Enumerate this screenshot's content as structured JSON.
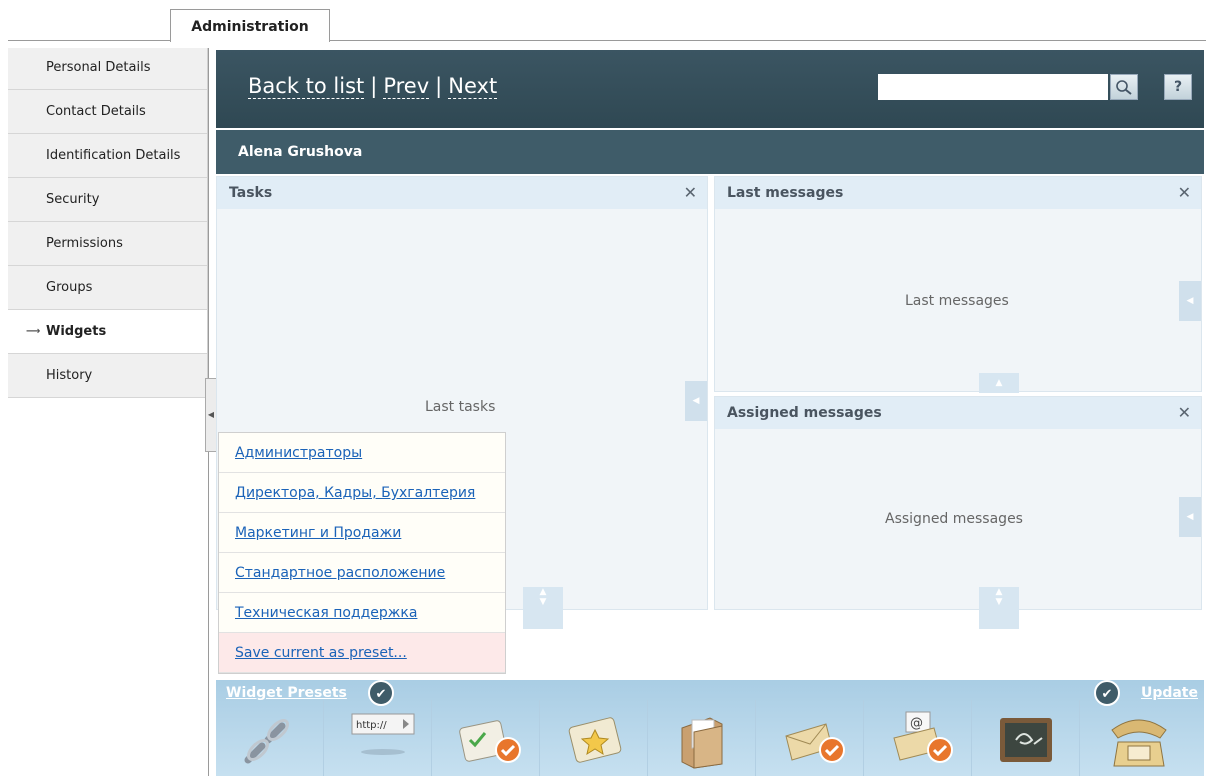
{
  "tab": {
    "label": "Administration"
  },
  "sidebar": {
    "items": [
      {
        "label": "Personal Details"
      },
      {
        "label": "Contact Details"
      },
      {
        "label": "Identification Details"
      },
      {
        "label": "Security"
      },
      {
        "label": "Permissions"
      },
      {
        "label": "Groups"
      },
      {
        "label": "Widgets",
        "active": true
      },
      {
        "label": "History"
      }
    ]
  },
  "header": {
    "back_label": "Back to list",
    "prev_label": "Prev",
    "next_label": "Next",
    "separator": "|",
    "search_placeholder": "",
    "help_label": "?"
  },
  "user": {
    "name": "Alena Grushova"
  },
  "widgets": {
    "tasks": {
      "title": "Tasks",
      "body": "Last tasks"
    },
    "last_messages": {
      "title": "Last messages",
      "body": "Last messages"
    },
    "assigned_messages": {
      "title": "Assigned messages",
      "body": "Assigned messages"
    },
    "close_glyph": "✕"
  },
  "presets": {
    "items": [
      "Администраторы",
      "Директора, Кадры, Бухгалтерия",
      "Маркетинг и Продажи",
      "Стандартное расположение",
      "Техническая поддержка"
    ],
    "save_label": "Save current as preset..."
  },
  "toolbar": {
    "presets_label": "Widget Presets",
    "update_label": "Update",
    "icons": [
      "link-icon",
      "url-icon",
      "tasks-icon",
      "favorites-icon",
      "documents-icon",
      "messages-icon",
      "email-icon",
      "chalkboard-icon",
      "phone-icon"
    ]
  },
  "colors": {
    "header": "#2f4853",
    "userbar": "#3f5c69",
    "link": "#1b63b8",
    "toolbar": "#a9cde4"
  }
}
